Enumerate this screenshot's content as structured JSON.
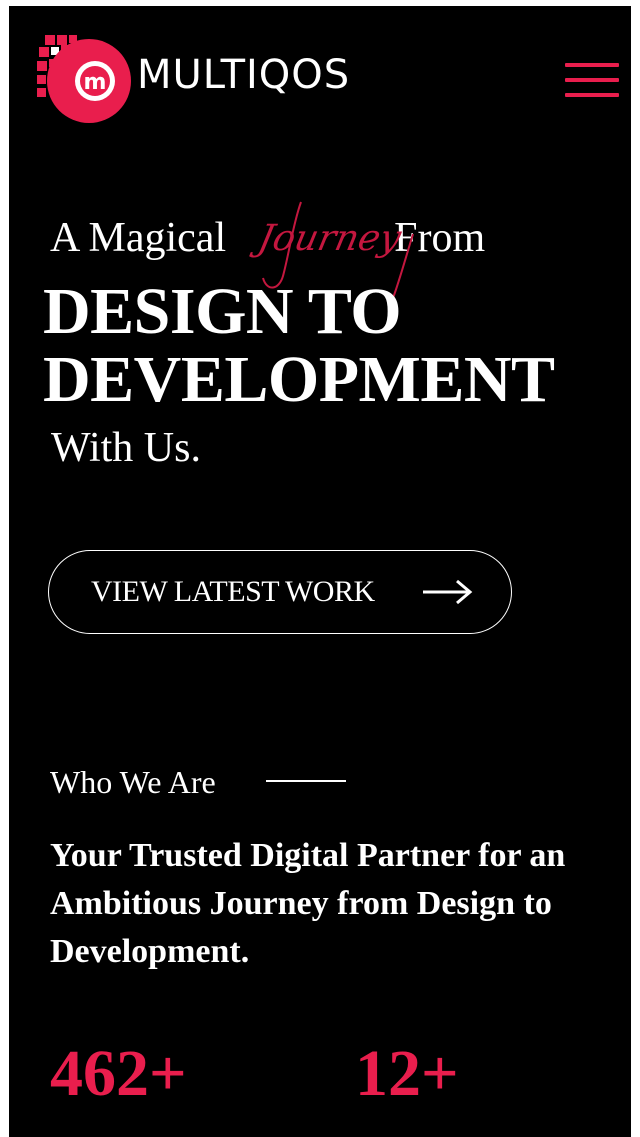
{
  "brand": {
    "name": "MULTIQOS",
    "logo_icon": "multiqos-m-logo",
    "accent_color": "#e91e4d"
  },
  "header": {
    "menu_icon": "hamburger-menu-icon"
  },
  "hero": {
    "lead_before": "A Magical",
    "script_word": "Journey",
    "lead_after": "From",
    "headline_line1": "DESIGN TO",
    "headline_line2": "DEVELOPMENT",
    "trailing": "With Us.",
    "cta_label": "VIEW LATEST WORK",
    "cta_icon": "arrow-right-icon"
  },
  "about": {
    "eyebrow": "Who We Are",
    "tagline": "Your Trusted Digital Partner for an Ambitious Journey from Design to Development."
  },
  "stats": [
    {
      "value": "462+"
    },
    {
      "value": "12+"
    }
  ],
  "colors": {
    "background": "#000000",
    "text": "#ffffff",
    "accent": "#e91e4d",
    "script": "#c4173f"
  }
}
